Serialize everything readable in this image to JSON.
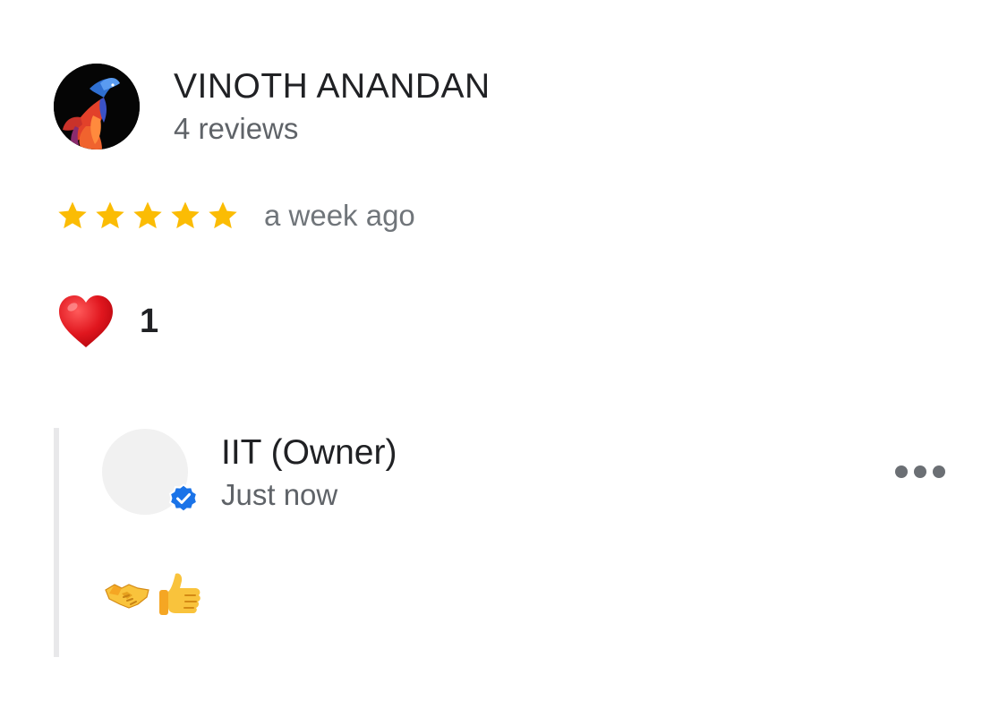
{
  "review": {
    "reviewer": {
      "name": "VINOTH ANANDAN",
      "review_count": "4 reviews",
      "avatar_icon": "betta-fish-avatar"
    },
    "rating": {
      "stars": 5,
      "max_stars": 5,
      "star_color": "#fbbc04",
      "time": "a week ago"
    },
    "reaction": {
      "icon": "red-heart-icon",
      "count": "1"
    },
    "owner_reply": {
      "name": "IIT (Owner)",
      "time": "Just now",
      "verified_color": "#1a73e8",
      "more_icon": "more-horizontal-icon",
      "body_icons": [
        "handshake-icon",
        "thumbs-up-icon"
      ]
    }
  }
}
